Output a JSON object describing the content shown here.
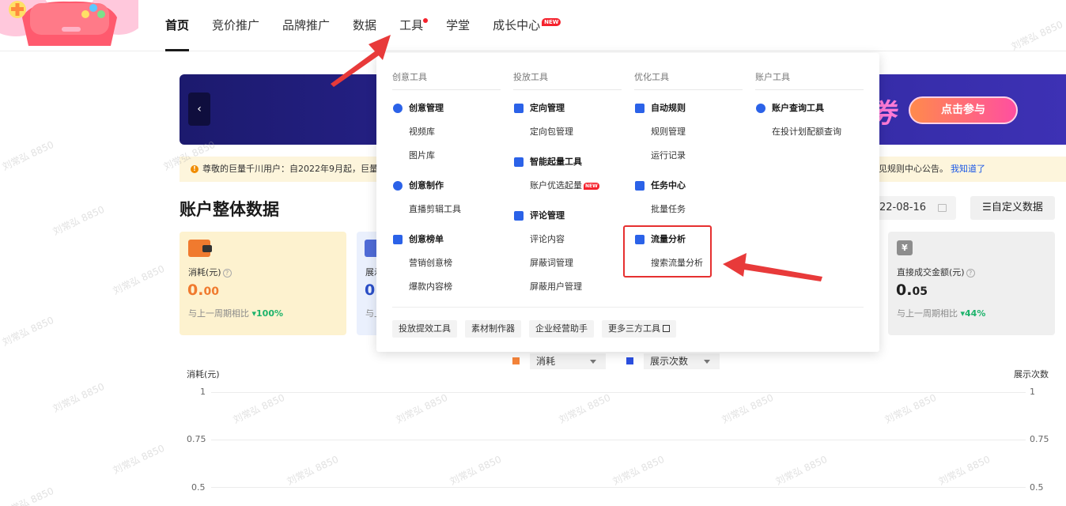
{
  "nav": {
    "items": [
      "首页",
      "竞价推广",
      "品牌推广",
      "数据",
      "工具",
      "学堂",
      "成长中心"
    ],
    "active": "首页",
    "new_badge": "NEW"
  },
  "banner": {
    "prev_arrow": "‹",
    "deco_text": "券",
    "cta": "点击参与"
  },
  "notice": {
    "text": "尊敬的巨量千川用户：自2022年9月起，巨量千",
    "tail": "见规则中心公告。",
    "link": "我知道了"
  },
  "overview": {
    "title": "账户整体数据",
    "date_end": "22-08-16",
    "custom_button": "自定义数据"
  },
  "cards": [
    {
      "label": "消耗(元)",
      "value_int": "0.",
      "value_dec": "00",
      "value_color": "#f07a2e",
      "compare_prefix": "与上一周期相比",
      "compare_value": "▾100%"
    },
    {
      "label": "展示",
      "value_int": "0",
      "value_color": "#2b4fc7",
      "compare_prefix": "与上"
    },
    {
      "label": "直接成交金额(元)",
      "value_int": "0.",
      "value_dec": "05",
      "value_color": "#1a1a1a",
      "compare_prefix": "与上一周期相比",
      "compare_value": "▾44%",
      "icon": "¥"
    }
  ],
  "legend": [
    {
      "label": "消耗",
      "color": "#f5843a"
    },
    {
      "label": "展示次数",
      "color": "#2b4fe0"
    }
  ],
  "chart": {
    "left_axis_title": "消耗(元)",
    "right_axis_title": "展示次数",
    "ticks": [
      "1",
      "0.75",
      "0.5"
    ]
  },
  "watermark": "刘常弘 8850",
  "tools_menu": {
    "columns": [
      {
        "head": "创意工具",
        "groups": [
          {
            "title": "创意管理",
            "icon": "bulb-icon",
            "items": [
              "视频库",
              "图片库"
            ]
          },
          {
            "title": "创意制作",
            "icon": "palette-icon",
            "items": [
              "直播剪辑工具"
            ]
          },
          {
            "title": "创意榜单",
            "icon": "ranking-icon",
            "items": [
              "营销创意榜",
              "爆款内容榜"
            ]
          }
        ]
      },
      {
        "head": "投放工具",
        "groups": [
          {
            "title": "定向管理",
            "icon": "target-user-icon",
            "items": [
              "定向包管理"
            ]
          },
          {
            "title": "智能起量工具",
            "icon": "trend-icon",
            "items": [
              "账户优选起量"
            ]
          },
          {
            "title": "评论管理",
            "icon": "comment-icon",
            "items": [
              "评论内容",
              "屏蔽词管理",
              "屏蔽用户管理"
            ]
          }
        ]
      },
      {
        "head": "优化工具",
        "groups": [
          {
            "title": "自动规则",
            "icon": "rule-icon",
            "items": [
              "规则管理",
              "运行记录"
            ]
          },
          {
            "title": "任务中心",
            "icon": "task-icon",
            "items": [
              "批量任务"
            ]
          },
          {
            "title": "流量分析",
            "icon": "traffic-chart-icon",
            "items": [
              "搜索流量分析"
            ]
          }
        ]
      },
      {
        "head": "账户工具",
        "groups": [
          {
            "title": "账户查询工具",
            "icon": "account-search-icon",
            "items": [
              "在投计划配额查询"
            ]
          }
        ]
      }
    ],
    "new_badge": "NEW",
    "footer": [
      "投放提效工具",
      "素材制作器",
      "企业经营助手",
      "更多三方工具"
    ]
  }
}
